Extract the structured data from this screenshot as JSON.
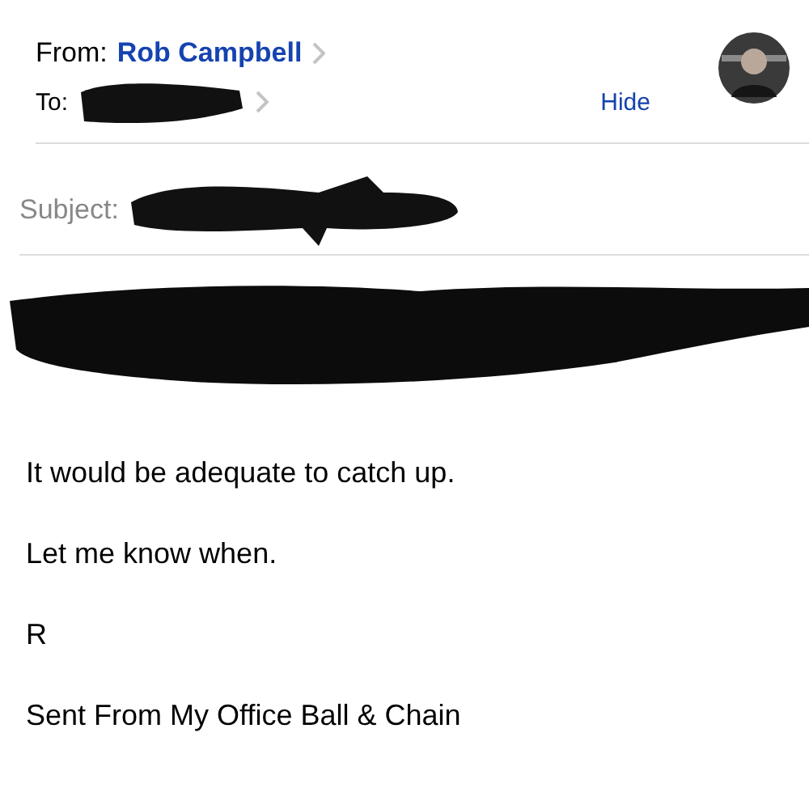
{
  "header": {
    "from_label": "From:",
    "from_name": "Rob Campbell",
    "to_label": "To:",
    "hide_link": "Hide",
    "avatar": {
      "kind": "silhouette"
    }
  },
  "subject": {
    "label": "Subject:"
  },
  "body": {
    "paragraphs": [
      {
        "kind": "redacted"
      },
      {
        "kind": "text",
        "text": "It would be adequate to catch up."
      },
      {
        "kind": "text",
        "text": "Let me know when."
      },
      {
        "kind": "text",
        "text": "R"
      },
      {
        "kind": "text",
        "text": "Sent From My Office Ball & Chain"
      }
    ]
  }
}
